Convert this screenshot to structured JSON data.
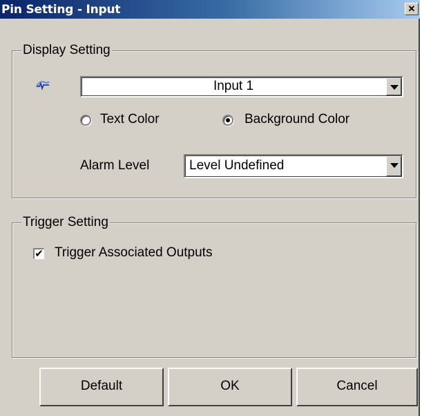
{
  "window": {
    "title": "Pin Setting - Input",
    "close_glyph": "✕"
  },
  "display_setting": {
    "legend": "Display Setting",
    "icon": "input-signal-icon",
    "input_select_value": "Input 1",
    "radio_text_color_label": "Text Color",
    "radio_background_color_label": "Background Color",
    "selected_radio": "Background Color",
    "alarm_level_label": "Alarm Level",
    "alarm_level_value": "Level Undefined"
  },
  "trigger_setting": {
    "legend": "Trigger Setting",
    "trigger_outputs_label": "Trigger Associated Outputs",
    "trigger_outputs_checked": true,
    "check_glyph": "✔"
  },
  "buttons": {
    "default_label": "Default",
    "ok_label": "OK",
    "cancel_label": "Cancel"
  },
  "colors": {
    "face": "#d4d0c8",
    "title_active_start": "#0a246a",
    "title_active_end": "#a6caf0"
  }
}
